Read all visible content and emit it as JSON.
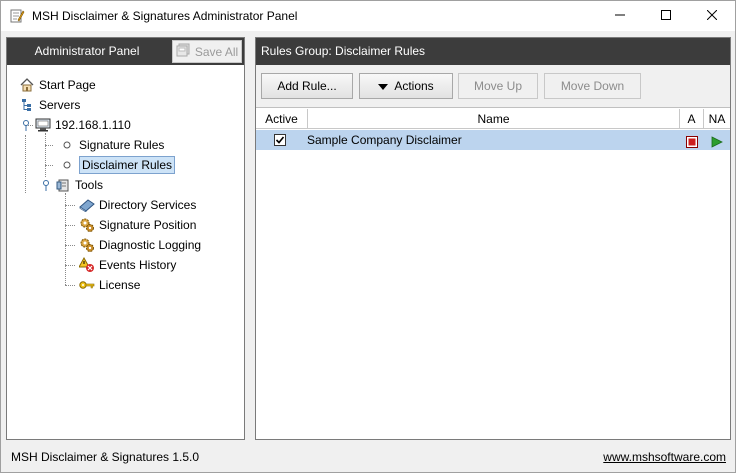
{
  "window": {
    "title": "MSH Disclaimer & Signatures Administrator Panel",
    "controls": [
      "minimize-icon",
      "maximize-icon",
      "close-icon"
    ]
  },
  "left_panel": {
    "title": "Administrator Panel",
    "save_all_label": "Save All",
    "tree": [
      {
        "label": "Start Page",
        "icon": "home-icon"
      },
      {
        "label": "Servers",
        "icon": "tree-icon"
      },
      {
        "label": "192.168.1.110",
        "icon": "computer-icon"
      },
      {
        "label": "Signature Rules",
        "icon": "bullet-icon"
      },
      {
        "label": "Disclaimer Rules",
        "icon": "bullet-icon",
        "selected": true
      },
      {
        "label": "Tools",
        "icon": "tools-icon"
      },
      {
        "label": "Directory Services",
        "icon": "book-icon"
      },
      {
        "label": "Signature Position",
        "icon": "gear-icon"
      },
      {
        "label": "Diagnostic Logging",
        "icon": "gear-icon"
      },
      {
        "label": "Events History",
        "icon": "warning-icon"
      },
      {
        "label": "License",
        "icon": "key-icon"
      }
    ]
  },
  "right_panel": {
    "title": "Rules Group: Disclaimer Rules",
    "toolbar": {
      "add_rule": "Add Rule...",
      "actions": "Actions",
      "move_up": "Move Up",
      "move_down": "Move Down"
    },
    "table": {
      "columns": [
        "Active",
        "Name",
        "A",
        "NA"
      ],
      "rows": [
        {
          "active": true,
          "name": "Sample Company Disclaimer",
          "a": "stop-icon",
          "na": "play-icon"
        }
      ]
    }
  },
  "statusbar": {
    "version": "MSH Disclaimer & Signatures 1.5.0",
    "link": "www.mshsoftware.com"
  },
  "colors": {
    "header_bg": "#3c3c3c",
    "selected_row": "#bcd4ee",
    "stop_red": "#cc1f1f",
    "play_green": "#2e9e2e"
  }
}
